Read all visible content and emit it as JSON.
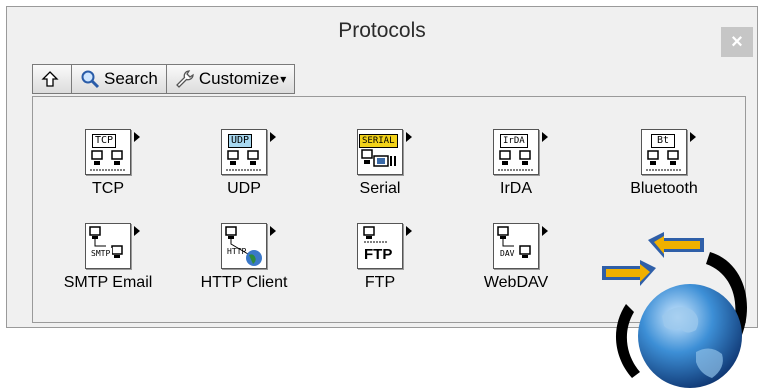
{
  "window": {
    "title": "Protocols",
    "close_label": "×"
  },
  "toolbar": {
    "up_icon": "up-arrow-icon",
    "search_label": "Search",
    "customize_label": "Customize",
    "customize_arrow": "▾"
  },
  "items": [
    {
      "label": "TCP",
      "tag": "TCP",
      "icon": "tcp-icon"
    },
    {
      "label": "UDP",
      "tag": "UDP",
      "icon": "udp-icon"
    },
    {
      "label": "Serial",
      "tag": "SERIAL",
      "icon": "serial-icon"
    },
    {
      "label": "IrDA",
      "tag": "IrDA",
      "icon": "irda-icon"
    },
    {
      "label": "Bluetooth",
      "tag": "Bt",
      "icon": "bluetooth-icon"
    },
    {
      "label": "SMTP Email",
      "tag": "SMTP",
      "icon": "smtp-icon"
    },
    {
      "label": "HTTP Client",
      "tag": "HTTP",
      "icon": "http-icon"
    },
    {
      "label": "FTP",
      "tag": "FTP",
      "icon": "ftp-icon"
    },
    {
      "label": "WebDAV",
      "tag": "DAV",
      "icon": "webdav-icon"
    }
  ],
  "colors": {
    "udp_tag": "#a8d8f0",
    "serial_tag": "#f2d21a",
    "arrow_blue": "#2f5fa8",
    "arrow_orange": "#f0b000"
  }
}
